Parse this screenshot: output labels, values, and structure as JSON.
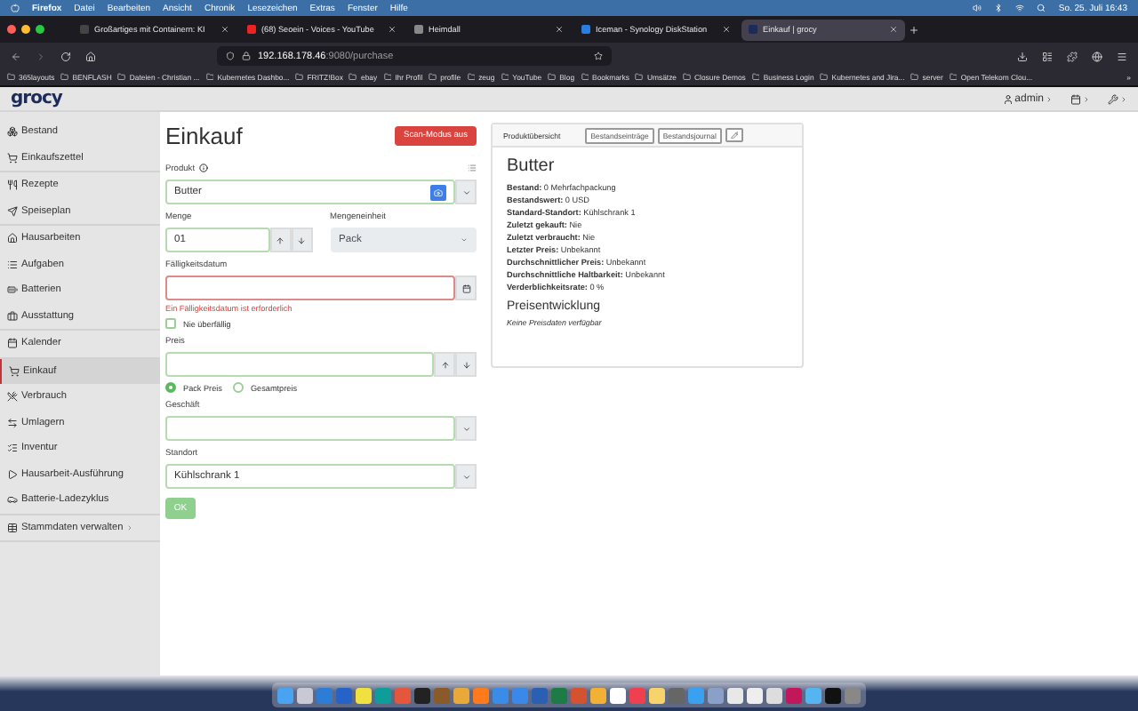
{
  "menu_bar": {
    "items": [
      "Firefox",
      "Datei",
      "Bearbeiten",
      "Ansicht",
      "Chronik",
      "Lesezeichen",
      "Extras",
      "Fenster",
      "Hilfe"
    ],
    "clock": "So. 25. Juli 16:43"
  },
  "browser": {
    "tabs": [
      {
        "title": "Großartiges mit Containern: KI",
        "selected": false
      },
      {
        "title": "(68) Seoein - Voices - YouTube",
        "selected": false
      },
      {
        "title": "Heimdall",
        "selected": false
      },
      {
        "title": "Iceman - Synology DiskStation",
        "selected": false
      },
      {
        "title": "Einkauf | grocy",
        "selected": true
      }
    ],
    "url_host": "192.168.178.46",
    "url_path": ":9080/purchase",
    "bookmarks": [
      "365layouts",
      "BENFLASH",
      "Dateien - Christian ...",
      "Kubernetes Dashbo...",
      "FRITZ!Box",
      "ebay",
      "Ihr Profil",
      "profile",
      "zeug",
      "YouTube",
      "Blog",
      "Bookmarks",
      "Umsätze",
      "Closure Demos",
      "Business Login",
      "Kubernetes and Jira...",
      "server",
      "Open Telekom Clou..."
    ],
    "bookmarks_more": "»"
  },
  "app": {
    "logo": "grocy",
    "user": "admin",
    "sidebar": [
      [
        {
          "label": "Bestand",
          "selected": false
        },
        {
          "label": "Einkaufszettel",
          "selected": false
        }
      ],
      [
        {
          "label": "Rezepte",
          "selected": false
        },
        {
          "label": "Speiseplan",
          "selected": false
        }
      ],
      [
        {
          "label": "Hausarbeiten",
          "selected": false
        },
        {
          "label": "Aufgaben",
          "selected": false
        },
        {
          "label": "Batterien",
          "selected": false
        },
        {
          "label": "Ausstattung",
          "selected": false
        }
      ],
      [
        {
          "label": "Kalender",
          "selected": false
        }
      ],
      [
        {
          "label": "Einkauf",
          "selected": true
        },
        {
          "label": "Verbrauch",
          "selected": false
        },
        {
          "label": "Umlagern",
          "selected": false
        },
        {
          "label": "Inventur",
          "selected": false
        },
        {
          "label": "Hausarbeit-Ausführung",
          "selected": false
        },
        {
          "label": "Batterie-Ladezyklus",
          "selected": false
        }
      ],
      [
        {
          "label": "Stammdaten verwalten",
          "selected": false
        }
      ]
    ],
    "form": {
      "title": "Einkauf",
      "scan_button": "Scan-Modus aus",
      "product": {
        "label": "Produkt",
        "value": "Butter"
      },
      "amount": {
        "label": "Menge",
        "value": "01"
      },
      "unit": {
        "label": "Mengeneinheit",
        "value": "Pack",
        "disabled": true
      },
      "due_date": {
        "label": "Fälligkeitsdatum",
        "invalid": true,
        "error": "Ein Fälligkeitsdatum ist erforderlich"
      },
      "never_overdue": {
        "label": "Nie überfällig",
        "checked": false
      },
      "price": {
        "label": "Preis"
      },
      "price_type": [
        {
          "label": "Pack Preis",
          "selected": true
        },
        {
          "label": "Gesamtpreis",
          "selected": false
        }
      ],
      "store": {
        "label": "Geschäft"
      },
      "location": {
        "label": "Standort",
        "value": "Kühlschrank 1"
      },
      "submit": {
        "label": "OK",
        "disabled": true
      }
    },
    "overview": {
      "header": "Produktübersicht",
      "buttons": [
        "Bestandseinträge",
        "Bestandsjournal"
      ],
      "product": "Butter",
      "facts": [
        "**Bestand:** 0 Mehrfachpackung",
        "**Bestandswert:** 0 USD",
        "**Standard-Standort:** Kühlschrank 1",
        "**Zuletzt gekauft:** Nie",
        "**Zuletzt verbraucht:** Nie",
        "**Letzter Preis:** Unbekannt",
        "**Durchschnittlicher Preis:** Unbekannt",
        "**Durchschnittliche Haltbarkeit:** Unbekannt",
        "**Verderblichkeitsrate:** 0 %"
      ],
      "price_heading": "Preisentwicklung",
      "price_empty": "Keine Preisdaten verfügbar"
    }
  }
}
